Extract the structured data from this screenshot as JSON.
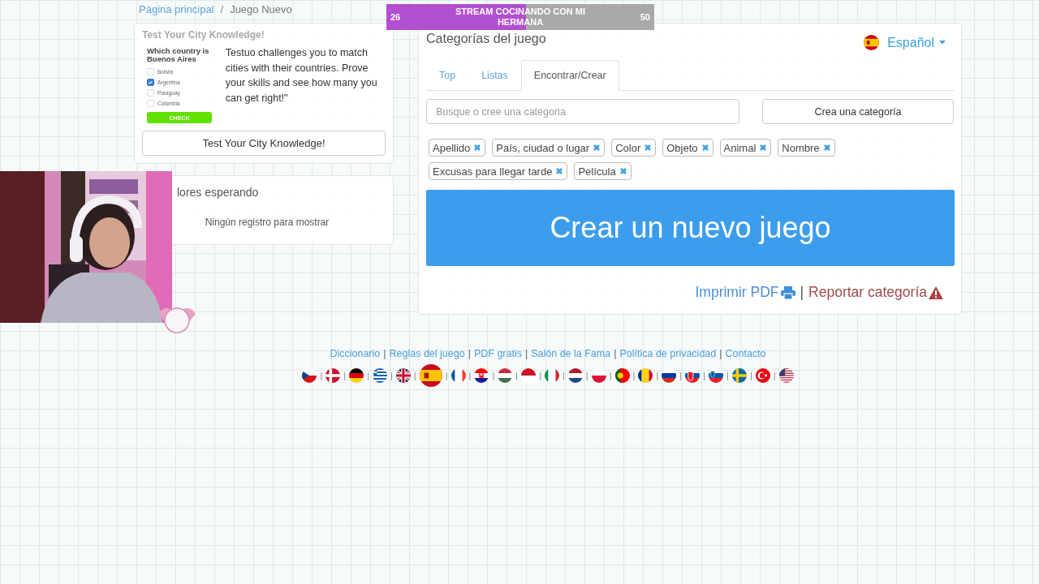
{
  "breadcrumb": {
    "separator": "/",
    "items": [
      {
        "label": "Página principal",
        "kind": "link"
      },
      {
        "label": "Juego Nuevo",
        "kind": "current"
      }
    ]
  },
  "stream_goal": {
    "start": "26",
    "title": "STREAM COCINANDO CON MI HERMANA",
    "end": "50",
    "level": 0.52
  },
  "promo": {
    "title": "Test Your City Knowledge!",
    "quiz": {
      "question": "Which country is Buenos Aires",
      "options": [
        {
          "label": "Bolivia",
          "checked": false
        },
        {
          "label": "Argentina",
          "checked": true
        },
        {
          "label": "Paraguay",
          "checked": false
        },
        {
          "label": "Colombia",
          "checked": false
        }
      ],
      "button": "CHECK"
    },
    "description": "Testuo challenges you to match cities with their countries. Prove your skills and see how many you can get right!\"",
    "button": "Test Your City Knowledge!"
  },
  "waiting_players": {
    "title": "lores esperando",
    "empty_text": "Ningún registro para mostrar"
  },
  "categories": {
    "title": "Categorías del juego",
    "language": {
      "label": "Español",
      "kind": "es"
    },
    "tabs": [
      {
        "label": "Top",
        "selected": false
      },
      {
        "label": "Listas",
        "selected": false
      },
      {
        "label": "Encontrar/Crear",
        "selected": true
      }
    ],
    "search": {
      "placeholder": "Busque o cree una categoria"
    },
    "create_button": "Crea una categoría",
    "tags": [
      "Apellido",
      "País, ciudad o lugar",
      "Color",
      "Objeto",
      "Animal",
      "Nombre",
      "Excusas para llegar tarde",
      "Película"
    ],
    "new_game_button": "Crear un nuevo juego",
    "separator": "|",
    "actions": [
      {
        "label": "Imprimir PDF",
        "kind": "print"
      },
      {
        "label": "Reportar categoría",
        "kind": "report"
      }
    ]
  },
  "footer": {
    "separator": "|",
    "links": [
      "Diccionario",
      "Reglas del juego",
      "PDF gratis",
      "Salón de la Fama",
      "Política de privacidad",
      "Contacto"
    ],
    "flags": [
      {
        "kind": "cz",
        "selected": false
      },
      {
        "kind": "dk",
        "selected": false
      },
      {
        "kind": "de",
        "selected": false
      },
      {
        "kind": "gr",
        "selected": false
      },
      {
        "kind": "gb",
        "selected": false
      },
      {
        "kind": "es",
        "selected": true
      },
      {
        "kind": "fr",
        "selected": false
      },
      {
        "kind": "hr",
        "selected": false
      },
      {
        "kind": "hu",
        "selected": false
      },
      {
        "kind": "id",
        "selected": false
      },
      {
        "kind": "it",
        "selected": false
      },
      {
        "kind": "nl",
        "selected": false
      },
      {
        "kind": "pl",
        "selected": false
      },
      {
        "kind": "pt",
        "selected": false
      },
      {
        "kind": "ro",
        "selected": false
      },
      {
        "kind": "ru",
        "selected": false
      },
      {
        "kind": "sk",
        "selected": false
      },
      {
        "kind": "si",
        "selected": false
      },
      {
        "kind": "se",
        "selected": false
      },
      {
        "kind": "tr",
        "selected": false
      },
      {
        "kind": "us",
        "selected": false
      }
    ]
  }
}
